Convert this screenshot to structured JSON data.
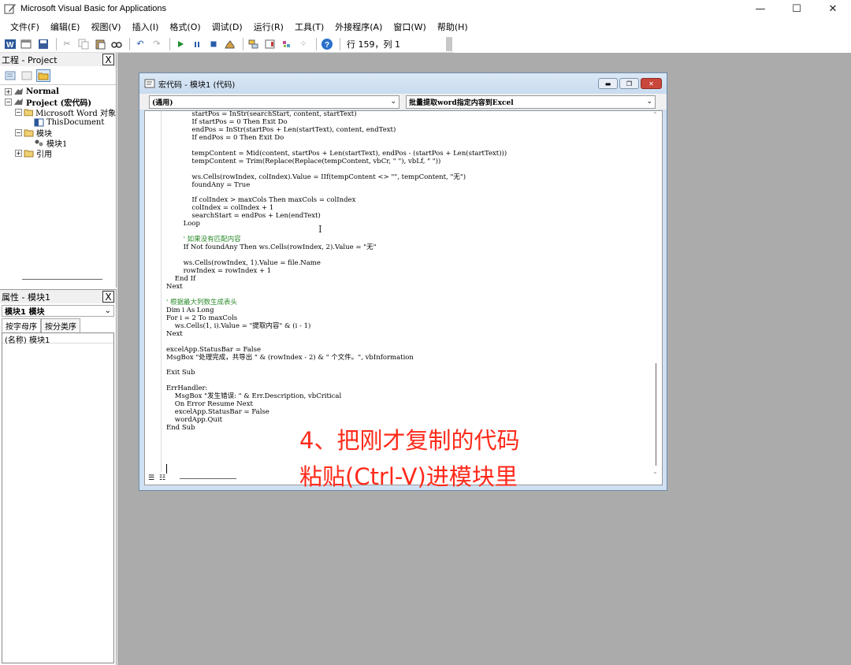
{
  "window": {
    "title": "Microsoft Visual Basic for Applications",
    "minimize": "—",
    "maximize": "☐",
    "close": "✕"
  },
  "menu": [
    "文件(F)",
    "编辑(E)",
    "视图(V)",
    "插入(I)",
    "格式(O)",
    "调试(D)",
    "运行(R)",
    "工具(T)",
    "外接程序(A)",
    "窗口(W)",
    "帮助(H)"
  ],
  "toolbar": {
    "position": "行 159，列 1"
  },
  "project_pane": {
    "title": "工程 - Project",
    "close": "X",
    "tree": [
      {
        "label": "Normal",
        "expander": "+",
        "level": 0,
        "bold": true
      },
      {
        "label": "Project (宏代码)",
        "expander": "−",
        "level": 0,
        "bold": true
      },
      {
        "label": "Microsoft Word 对象",
        "expander": "−",
        "level": 1,
        "bold": false
      },
      {
        "label": "ThisDocument",
        "expander": "",
        "level": 2,
        "bold": false
      },
      {
        "label": "模块",
        "expander": "−",
        "level": 1,
        "bold": false
      },
      {
        "label": "模块1",
        "expander": "",
        "level": 2,
        "bold": false
      },
      {
        "label": "引用",
        "expander": "+",
        "level": 1,
        "bold": false
      }
    ]
  },
  "props_pane": {
    "title": "属性 - 模块1",
    "close": "X",
    "object": "模块1 模块",
    "tabs": [
      "按字母序",
      "按分类序"
    ],
    "rows": [
      "(名称) 模块1"
    ]
  },
  "code_window": {
    "title": "宏代码 - 模块1 (代码)",
    "object_combo": "(通用)",
    "proc_combo": "批量提取word指定内容到Excel",
    "code": [
      "            startPos = InStr(searchStart, content, startText)",
      "            If startPos = 0 Then Exit Do",
      "            endPos = InStr(startPos + Len(startText), content, endText)",
      "            If endPos = 0 Then Exit Do",
      "",
      "            tempContent = Mid(content, startPos + Len(startText), endPos - (startPos + Len(startText)))",
      "            tempContent = Trim(Replace(Replace(tempContent, vbCr, \" \"), vbLf, \" \"))",
      "",
      "            ws.Cells(rowIndex, colIndex).Value = IIf(tempContent <> \"\", tempContent, \"无\")",
      "            foundAny = True",
      "",
      "            If colIndex > maxCols Then maxCols = colIndex",
      "            colIndex = colIndex + 1",
      "            searchStart = endPos + Len(endText)",
      "        Loop",
      "",
      "        ' 如果没有匹配内容",
      "        If Not foundAny Then ws.Cells(rowIndex, 2).Value = \"无\"",
      "",
      "        ws.Cells(rowIndex, 1).Value = file.Name",
      "        rowIndex = rowIndex + 1",
      "    End If",
      "Next",
      "",
      "' 根据最大列数生成表头",
      "Dim i As Long",
      "For i = 2 To maxCols",
      "    ws.Cells(1, i).Value = \"提取内容\" & (i - 1)",
      "Next",
      "",
      "excelApp.StatusBar = False",
      "MsgBox \"处理完成，共导出 \" & (rowIndex - 2) & \" 个文件。\", vbInformation",
      "",
      "Exit Sub",
      "",
      "ErrHandler:",
      "    MsgBox \"发生错误: \" & Err.Description, vbCritical",
      "    On Error Resume Next",
      "    excelApp.StatusBar = False",
      "    wordApp.Quit",
      "End Sub"
    ]
  },
  "caption": "4、把刚才复制的代码\n粘贴(Ctrl-V)进模块里",
  "colors": {
    "workspace": "#ababab",
    "comment": "#2a8a2a",
    "caption": "#ff2a1a",
    "close_button": "#c9473a"
  }
}
